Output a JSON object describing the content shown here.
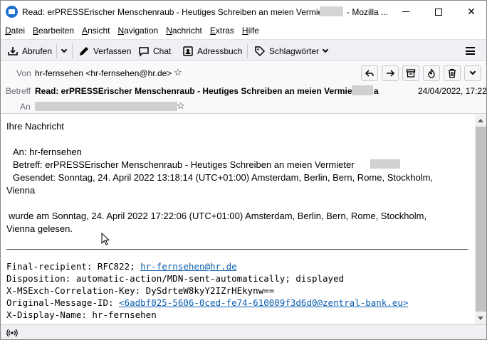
{
  "window": {
    "title": "Read: erPRESSErischer Menschenraub - Heutiges Schreiben an meien Vermieter",
    "title_suffix": "- Mozilla ...",
    "minimize_label": "",
    "maximize_label": "",
    "close_label": "✕"
  },
  "menu": {
    "items": [
      "Datei",
      "Bearbeiten",
      "Ansicht",
      "Navigation",
      "Nachricht",
      "Extras",
      "Hilfe"
    ]
  },
  "toolbar": {
    "fetch_label": "Abrufen",
    "compose_label": "Verfassen",
    "chat_label": "Chat",
    "addressbook_label": "Adressbuch",
    "tags_label": "Schlagwörter"
  },
  "header": {
    "from_label": "Von",
    "from_value": "hr-fernsehen <hr-fernsehen@hr.de>",
    "subject_label": "Betreff",
    "subject_value": "Read: erPRESSErischer Menschenraub - Heutiges Schreiben an meien Vermieter",
    "subject_tail": "a",
    "to_label": "An",
    "date": "24/04/2022, 17:22"
  },
  "body": {
    "greeting": "Ihre Nachricht",
    "to_line": "An: hr-fernsehen",
    "subject_line": "Betreff: erPRESSErischer Menschenraub - Heutiges Schreiben an meien Vermieter",
    "sent_line": "Gesendet: Sonntag, 24. April 2022 13:18:14 (UTC+01:00) Amsterdam, Berlin, Bern, Rome, Stockholm,",
    "sent_line2": "Vienna",
    "read_line": "wurde am Sonntag, 24. April 2022 17:22:06 (UTC+01:00) Amsterdam, Berlin, Bern, Rome, Stockholm,",
    "read_line2": "Vienna gelesen.",
    "final_recipient_label": "Final-recipient: RFC822;",
    "final_recipient_link": "hr-fernsehen@hr.de",
    "disposition": "Disposition: automatic-action/MDN-sent-automatically; displayed",
    "correlation_key": "X-MSExch-Correlation-Key: DySdrteW8kyY2IZrHEkynw==",
    "original_message_id_label": "Original-Message-ID:",
    "original_message_id_link": "<6adbf025-5606-0ced-fe74-610009f3d6d0@zentral-bank.eu>",
    "display_name": "X-Display-Name: hr-fernsehen"
  },
  "colors": {
    "link": "#0b5fb0",
    "toolbar_bg": "#f0f0f4",
    "header_bg": "#f9f9fb",
    "app_icon": "#1f6fd0"
  }
}
